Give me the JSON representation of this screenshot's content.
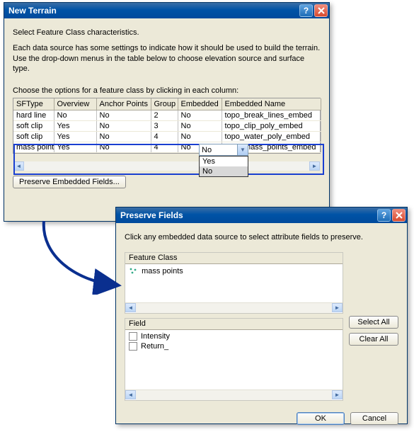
{
  "win1": {
    "title": "New Terrain",
    "instr1": "Select Feature Class characteristics.",
    "instr2": "Each data source has some settings to indicate how it should be used to build the terrain.  Use the drop-down menus in the table below to choose elevation source and surface type.",
    "choose": "Choose the options for a feature class by clicking in each column:",
    "headers": {
      "sf": "SFType",
      "ov": "Overview",
      "ap": "Anchor Points",
      "gr": "Group",
      "em": "Embedded",
      "en": "Embedded Name"
    },
    "rows": [
      {
        "sf": "hard line",
        "ov": "No",
        "ap": "No",
        "gr": "2",
        "em": "No",
        "en": "topo_break_lines_embed"
      },
      {
        "sf": "soft clip",
        "ov": "Yes",
        "ap": "No",
        "gr": "3",
        "em": "No",
        "en": "topo_clip_poly_embed"
      },
      {
        "sf": "soft clip",
        "ov": "Yes",
        "ap": "No",
        "gr": "4",
        "em": "No",
        "en": "topo_water_poly_embed"
      },
      {
        "sf": "mass points",
        "ov": "Yes",
        "ap": "No",
        "gr": "4",
        "em": "No",
        "en": "topo_mass_points_embed"
      }
    ],
    "combo_value": "No",
    "combo_options": [
      "Yes",
      "No"
    ],
    "preserve_btn": "Preserve Embedded Fields..."
  },
  "win2": {
    "title": "Preserve Fields",
    "instr": "Click any embedded data source to select attribute fields to preserve.",
    "feature_label": "Feature Class",
    "feature_item": "mass points",
    "field_label": "Field",
    "fields": [
      "Intensity",
      "Return_"
    ],
    "select_all": "Select All",
    "clear_all": "Clear All",
    "ok": "OK",
    "cancel": "Cancel"
  }
}
